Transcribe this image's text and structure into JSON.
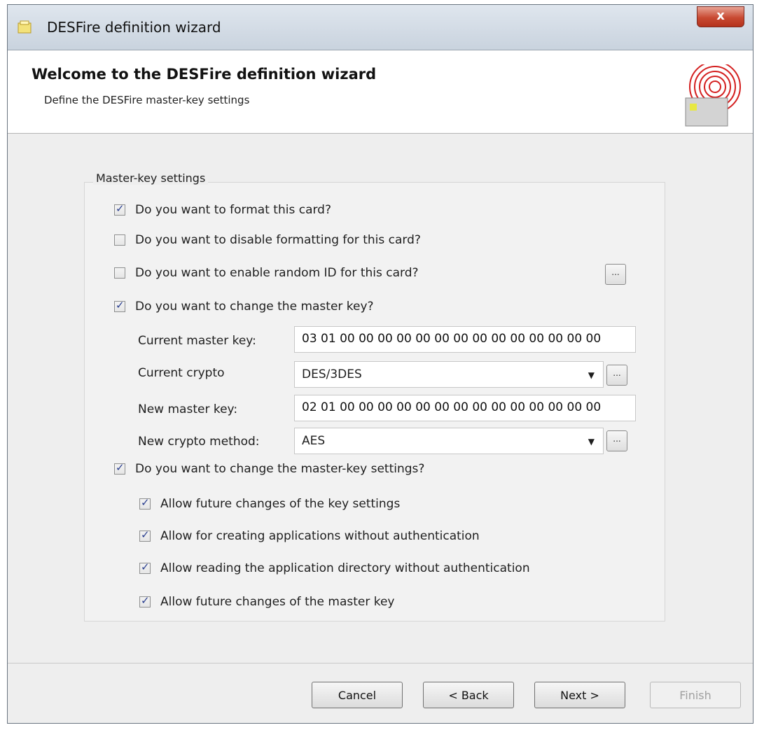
{
  "window": {
    "title": "DESFire definition wizard",
    "close_glyph": "x"
  },
  "header": {
    "title": "Welcome to the DESFire definition wizard",
    "subtitle": "Define the DESFire master-key settings",
    "icon": "rfid-card-icon"
  },
  "group": {
    "label": "Master-key settings"
  },
  "options": {
    "format_card": {
      "label": "Do you want to format this card?",
      "checked": true
    },
    "disable_formatting": {
      "label": "Do you want to disable formatting for this card?",
      "checked": false
    },
    "random_id": {
      "label": "Do you want to enable random ID for this card?",
      "checked": false,
      "button": "..."
    },
    "change_master_key": {
      "label": "Do you want to change the master key?",
      "checked": true
    },
    "change_key_settings": {
      "label": "Do you want to change the master-key settings?",
      "checked": true
    }
  },
  "keys": {
    "current_key_label": "Current master key:",
    "current_key_value": "03 01 00 00 00 00 00 00 00 00 00 00 00 00 00 00",
    "current_crypto_label": "Current crypto",
    "current_crypto_value": "DES/3DES",
    "new_key_label": "New master key:",
    "new_key_value": "02 01 00 00 00 00 00 00 00 00 00 00 00 00 00 00",
    "new_crypto_label": "New crypto method:",
    "new_crypto_value": "AES",
    "ellipsis": "..."
  },
  "sub_options": [
    {
      "label": "Allow future changes of the key settings",
      "checked": true
    },
    {
      "label": "Allow for creating applications without authentication",
      "checked": true
    },
    {
      "label": "Allow reading the application directory without authentication",
      "checked": true
    },
    {
      "label": "Allow future changes of the master key",
      "checked": true
    }
  ],
  "footer": {
    "cancel": "Cancel",
    "back": "< Back",
    "next": "Next >",
    "finish": "Finish"
  }
}
